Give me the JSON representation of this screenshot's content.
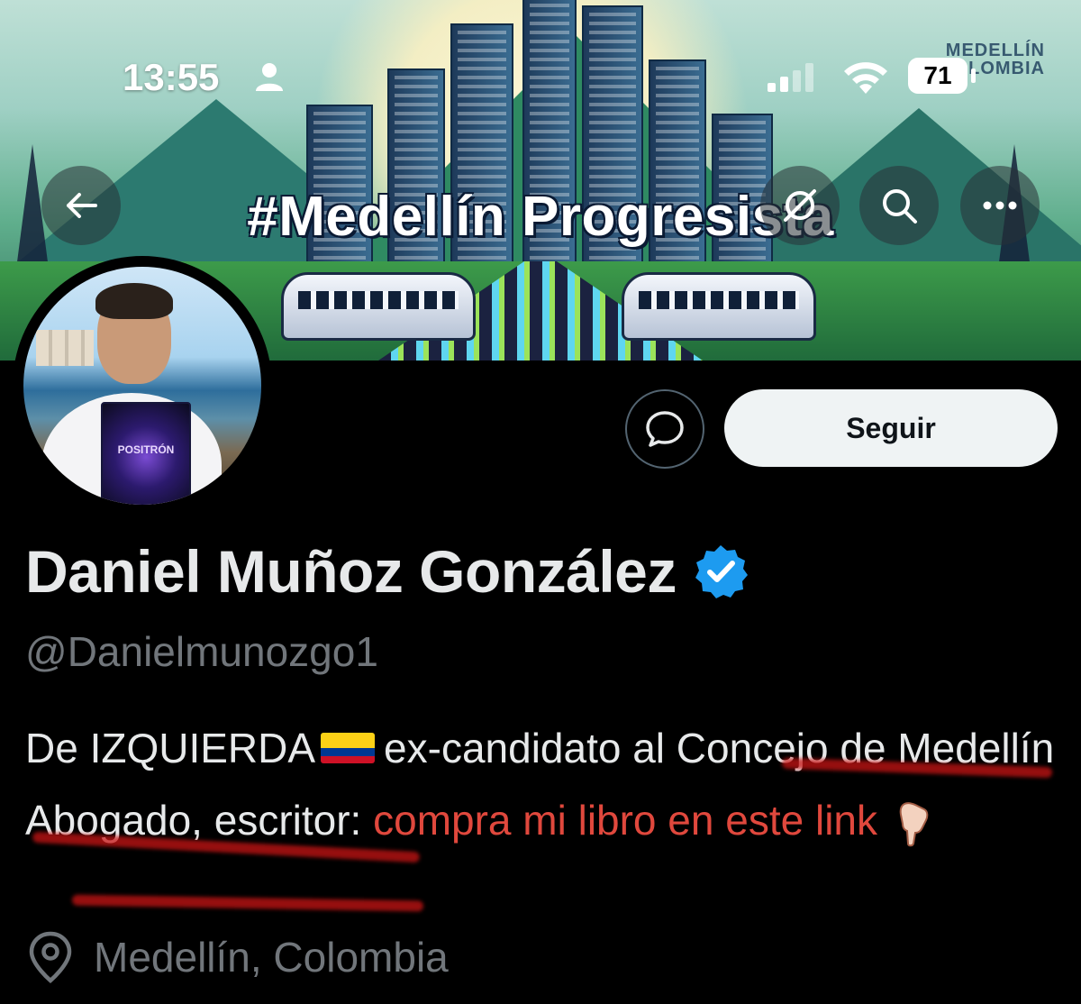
{
  "status_bar": {
    "time": "13:55",
    "battery": "71"
  },
  "banner": {
    "hashtag": "#Medellín Progresista",
    "brand_line1": "MEDELLÍN",
    "brand_line2": "COLOMBIA",
    "book_title": "POSITRÓN"
  },
  "header_actions": {
    "back": "back-arrow-icon",
    "grok": "grok-icon",
    "search": "search-icon",
    "more": "more-icon"
  },
  "actions": {
    "message_icon": "message-bubble-icon",
    "follow_label": "Seguir"
  },
  "profile": {
    "name": "Daniel Muñoz González",
    "handle": "@Danielmunozgo1",
    "bio_part1": "De IZQUIERDA",
    "bio_part2": "ex-candidato al Concejo de Medellín Abogado, escritor: ",
    "bio_link": "compra mi libro en este link",
    "location": "Medellín, Colombia"
  },
  "colors": {
    "verified": "#1d9bf0",
    "link": "#e0483d",
    "follow_bg": "#eff3f4",
    "muted": "#71767b"
  }
}
